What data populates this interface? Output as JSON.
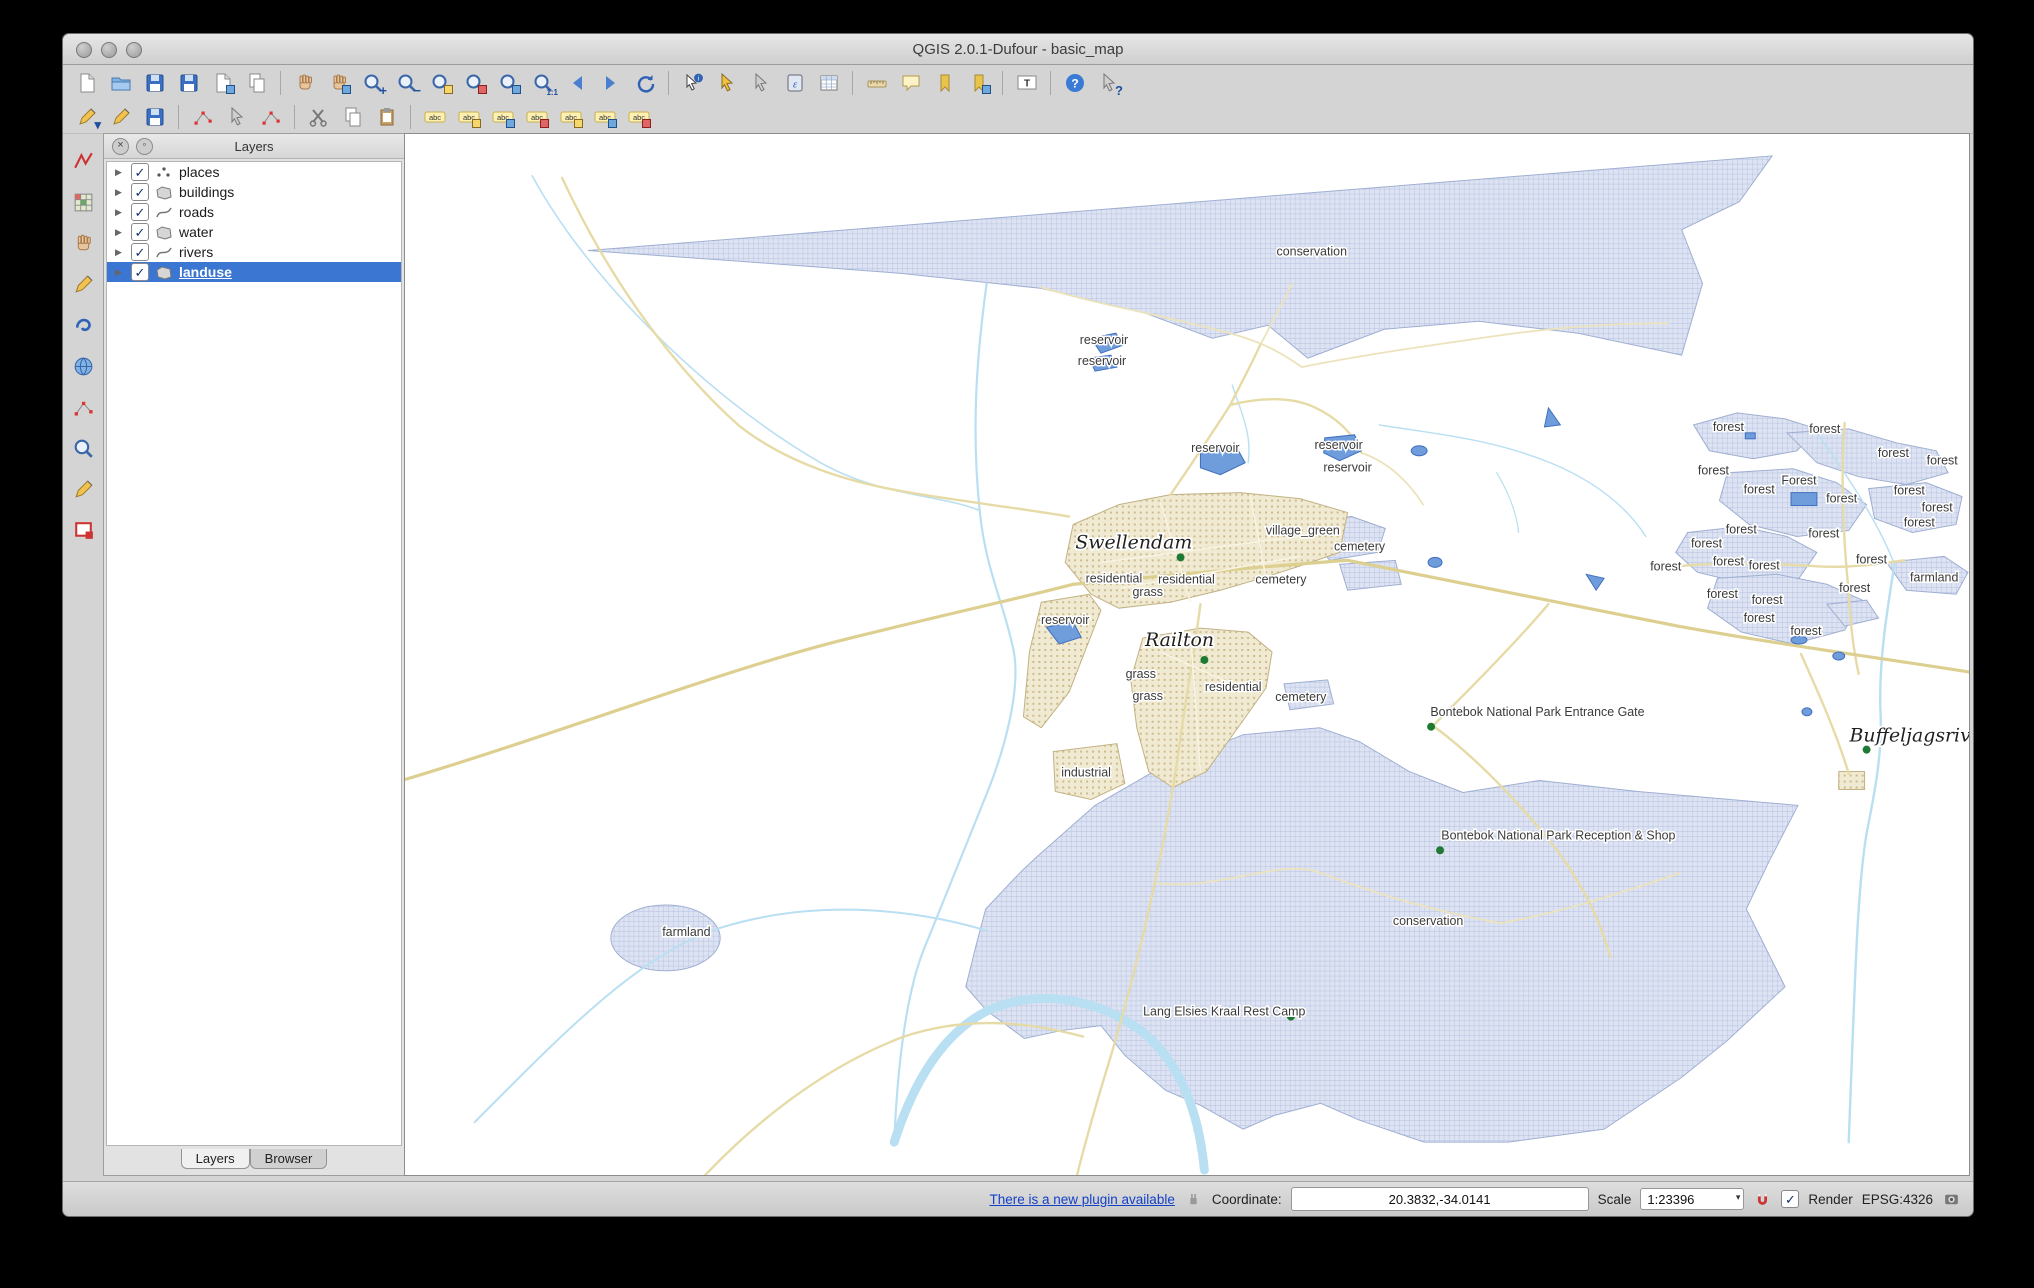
{
  "window": {
    "title": "QGIS 2.0.1-Dufour - basic_map"
  },
  "icons": {
    "plus": "+",
    "minus": "−",
    "one_to_one": "1:1",
    "question": "?",
    "expander": "▶",
    "check": "✓",
    "close": "×",
    "float": "◦",
    "combo_arrow": "▾"
  },
  "toolbar": {
    "row1": [
      "new-project",
      "open-project",
      "save-project",
      "save-project-as",
      "new-print-composer",
      "composer-manager",
      "pan-map",
      "touch-zoom-pan",
      "zoom-in",
      "zoom-out",
      "zoom-full",
      "zoom-to-selection",
      "zoom-to-layer",
      "zoom-native",
      "zoom-last",
      "zoom-next",
      "refresh-map",
      "identify-features",
      "select-features",
      "deselect-features",
      "field-calculator",
      "open-attribute-table",
      "measure-line",
      "map-tips",
      "new-bookmark",
      "show-bookmarks",
      "text-annotation",
      "help-contents",
      "whats-this"
    ],
    "row2": [
      "current-edits",
      "toggle-editing",
      "save-layer-edits",
      "add-feature",
      "move-feature",
      "node-tool",
      "cut-features",
      "copy-features",
      "paste-features",
      "layer-labeling",
      "label-pin",
      "label-show-hide",
      "label-move",
      "label-rotate",
      "label-change",
      "label-properties"
    ],
    "side": [
      "digitize-tool",
      "raster-tool",
      "pan-layer-tool",
      "sketch-tool",
      "plugin-tool",
      "web-plugin",
      "node-editor",
      "coordinate-capture",
      "annotation-eraser",
      "decorations"
    ]
  },
  "layers_panel": {
    "title": "Layers",
    "items": [
      {
        "name": "places",
        "checked": true
      },
      {
        "name": "buildings",
        "checked": true
      },
      {
        "name": "roads",
        "checked": true
      },
      {
        "name": "water",
        "checked": true
      },
      {
        "name": "rivers",
        "checked": true
      },
      {
        "name": "landuse",
        "checked": true,
        "selected": true
      }
    ],
    "tabs": [
      "Layers",
      "Browser"
    ]
  },
  "map": {
    "labels": [
      "conservation",
      "reservoir",
      "reservoir",
      "reservoir",
      "reservoir",
      "reservoir",
      "forest",
      "forest",
      "forest",
      "forest",
      "forest",
      "forest",
      "forest",
      "forest",
      "forest",
      "forest",
      "forest",
      "forest",
      "forest",
      "forest",
      "forest",
      "forest",
      "forest",
      "farmland",
      "forest",
      "forest",
      "forest",
      "forest",
      "forest",
      "village_green",
      "cemetery",
      "residential",
      "residential",
      "cemetery",
      "grass",
      "reservoir",
      "grass",
      "grass",
      "residential",
      "cemetery",
      "Bontebok National Park Entrance Gate",
      "industrial",
      "Bontebok National Park Reception & Shop",
      "conservation",
      "farmland",
      "Lang Elsies Kraal Rest Camp",
      "Forest"
    ],
    "towns": [
      "Swellendam",
      "Railton",
      "Buffeljagsrivier"
    ]
  },
  "status_bar": {
    "plugin_link": "There is a new plugin available",
    "coordinate_label": "Coordinate:",
    "coordinate_value": "20.3832,-34.0141",
    "scale_label": "Scale",
    "scale_value": "1:23396",
    "render_label": "Render",
    "crs": "EPSG:4326"
  }
}
